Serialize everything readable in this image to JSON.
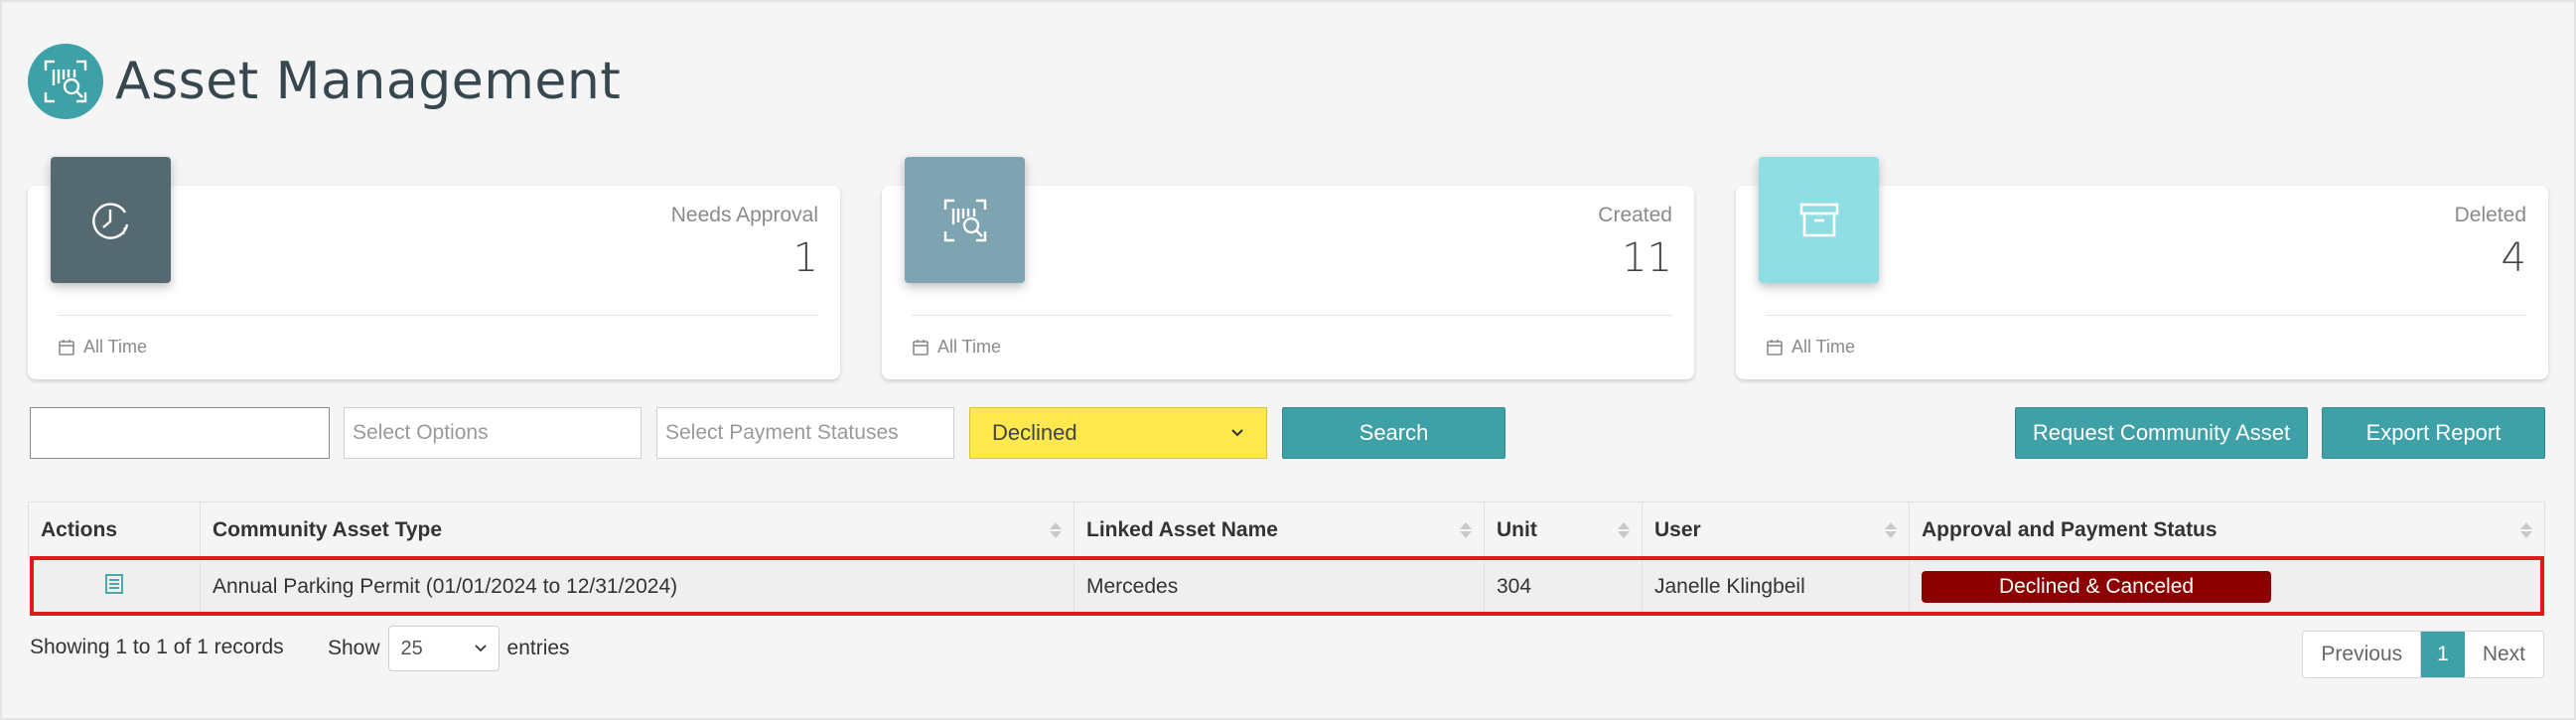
{
  "header": {
    "title": "Asset Management",
    "icon": "barcode-scan-icon",
    "accent_color": "#3ea1a7"
  },
  "stats": [
    {
      "label": "Needs Approval",
      "value": "1",
      "footer": "All Time",
      "icon": "clock-icon",
      "color": "#546a70"
    },
    {
      "label": "Created",
      "value": "11",
      "footer": "All Time",
      "icon": "barcode-scan-icon",
      "color": "#7ea3b1"
    },
    {
      "label": "Deleted",
      "value": "4",
      "footer": "All Time",
      "icon": "archive-box-icon",
      "color": "#8fdee4"
    }
  ],
  "filters": {
    "search_value": "",
    "options_placeholder": "Select Options",
    "payment_placeholder": "Select Payment Statuses",
    "status_selected": "Declined",
    "search_button": "Search",
    "request_button": "Request Community Asset",
    "export_button": "Export Report"
  },
  "table": {
    "columns": [
      "Actions",
      "Community Asset Type",
      "Linked Asset Name",
      "Unit",
      "User",
      "Approval and Payment Status"
    ],
    "rows": [
      {
        "action_icon": "details-icon",
        "asset_type": "Annual Parking Permit (01/01/2024 to 12/31/2024)",
        "linked_asset": "Mercedes",
        "unit": "304",
        "user": "Janelle Klingbeil",
        "status": "Declined & Canceled",
        "status_color": "#8b0000"
      }
    ]
  },
  "footer": {
    "info": "Showing 1 to 1 of 1 records",
    "show_label": "Show",
    "page_size": "25",
    "entries_label": "entries",
    "prev": "Previous",
    "current_page": "1",
    "next": "Next"
  }
}
